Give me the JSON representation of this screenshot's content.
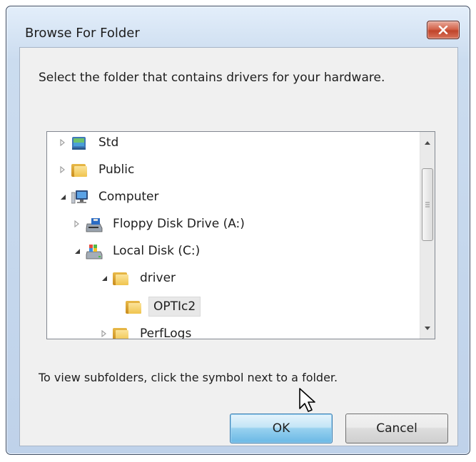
{
  "window": {
    "title": "Browse For Folder"
  },
  "dialog": {
    "instruction": "Select the folder that contains drivers for your hardware.",
    "hint": "To view subfolders, click the symbol next to a folder."
  },
  "tree": {
    "items": [
      {
        "label": "Std",
        "icon": "user-folder-icon",
        "expander": "collapsed"
      },
      {
        "label": "Public",
        "icon": "folder-icon",
        "expander": "collapsed"
      },
      {
        "label": "Computer",
        "icon": "computer-icon",
        "expander": "expanded"
      },
      {
        "label": "Floppy Disk Drive (A:)",
        "icon": "floppy-drive-icon",
        "expander": "collapsed"
      },
      {
        "label": "Local Disk (C:)",
        "icon": "local-disk-icon",
        "expander": "expanded"
      },
      {
        "label": "driver",
        "icon": "folder-icon",
        "expander": "expanded"
      },
      {
        "label": "OPTIc2",
        "icon": "folder-icon",
        "expander": "none",
        "selected": true
      },
      {
        "label": "PerfLogs",
        "icon": "folder-icon",
        "expander": "collapsed"
      }
    ]
  },
  "buttons": {
    "ok": "OK",
    "cancel": "Cancel"
  },
  "colors": {
    "close": "#c0442a",
    "default_button": "#98d1ef",
    "title_bar": "#cbdcef"
  }
}
